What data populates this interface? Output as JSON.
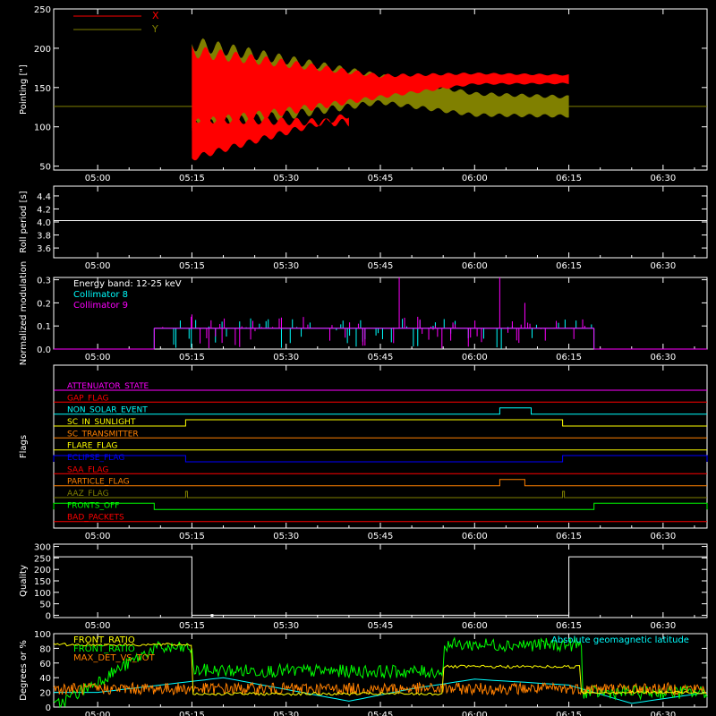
{
  "colors": {
    "background": "#000000",
    "axes": "#ffffff",
    "x_red": "#ff0000",
    "y_olive": "#808000",
    "cyan": "#00ffff",
    "magenta": "#ff00ff",
    "green": "#00ff00",
    "orange": "#ff8000",
    "yellow": "#ffff00",
    "blue": "#0000ff"
  },
  "time_ticks": [
    "05:00",
    "05:15",
    "05:30",
    "05:45",
    "06:00",
    "06:15",
    "06:30"
  ],
  "chart_data": [
    {
      "type": "line",
      "ylabel": "Pointing [\"]",
      "ylim": [
        45,
        250
      ],
      "yticks": [
        "50",
        "100",
        "150",
        "200",
        "250"
      ],
      "yticks_values": [
        50,
        100,
        150,
        200,
        250
      ],
      "x_range": [
        "04:53",
        "06:37"
      ],
      "series": [
        {
          "name": "X",
          "color": "#ff0000",
          "center": [
            126,
            126,
            145,
            158,
            158,
            126
          ],
          "amplitude": [
            0,
            70,
            20,
            10,
            8,
            0
          ],
          "x": [
            "04:53",
            "05:15",
            "05:45",
            "06:00",
            "06:15",
            "06:37"
          ]
        },
        {
          "name": "Y",
          "color": "#808000",
          "center": [
            126,
            126,
            140,
            122,
            120,
            126
          ],
          "amplitude": [
            0,
            80,
            25,
            20,
            18,
            0
          ],
          "x": [
            "04:53",
            "05:15",
            "05:45",
            "06:00",
            "06:15",
            "06:37"
          ]
        }
      ],
      "legend": [
        "X",
        "Y"
      ],
      "legend_position": "top-left"
    },
    {
      "type": "line",
      "ylabel": "Roll period [s]",
      "ylim": [
        3.45,
        4.55
      ],
      "yticks": [
        "3.6",
        "3.8",
        "4.0",
        "4.2",
        "4.4"
      ],
      "yticks_values": [
        3.6,
        3.8,
        4.0,
        4.2,
        4.4
      ],
      "series": [
        {
          "name": "",
          "x": [
            "04:53",
            "06:37"
          ],
          "y": [
            4.02,
            4.02
          ]
        }
      ]
    },
    {
      "type": "bar",
      "ylabel": "Normalized modulation",
      "ylim": [
        0,
        0.31
      ],
      "yticks": [
        "0.0",
        "0.1",
        "0.2",
        "0.3"
      ],
      "yticks_values": [
        0.0,
        0.1,
        0.2,
        0.3
      ],
      "annotation": "Energy band: 12-25 keV",
      "series": [
        {
          "name": "Collimator 8",
          "color": "#00ffff",
          "x_range": [
            "05:09",
            "06:19"
          ],
          "baseline": 0.09
        },
        {
          "name": "Collimator 9",
          "color": "#ff00ff",
          "x_range": [
            "05:09",
            "06:19"
          ],
          "baseline": 0.09
        }
      ],
      "legend_position": "top-left"
    },
    {
      "type": "line",
      "ylabel": "Flags",
      "flags": [
        {
          "name": "ATTENUATOR_STATE",
          "color": "#ff00ff",
          "on": []
        },
        {
          "name": "GAP_FLAG",
          "color": "#ff0000",
          "on": []
        },
        {
          "name": "NON_SOLAR_EVENT",
          "color": "#00ffff",
          "on": [
            [
              "06:04",
              "06:09"
            ]
          ]
        },
        {
          "name": "SC_IN_SUNLIGHT",
          "color": "#ffff00",
          "on": [
            [
              "05:14",
              "06:14"
            ]
          ]
        },
        {
          "name": "SC_TRANSMITTER",
          "color": "#ff8000",
          "on": []
        },
        {
          "name": "FLARE_FLAG",
          "color": "#ffff00",
          "on": []
        },
        {
          "name": "ECLIPSE_FLAG",
          "color": "#0000ff",
          "on": [
            [
              "04:53",
              "05:14"
            ],
            [
              "06:14",
              "06:37"
            ]
          ]
        },
        {
          "name": "SAA_FLAG",
          "color": "#ff0000",
          "on": []
        },
        {
          "name": "PARTICLE_FLAG",
          "color": "#ff8000",
          "on": [
            [
              "06:04",
              "06:08"
            ]
          ]
        },
        {
          "name": "AAZ_FLAG",
          "color": "#808000",
          "on": [
            [
              "05:14",
              "05:14"
            ],
            [
              "06:14",
              "06:14"
            ]
          ]
        },
        {
          "name": "FRONTS_OFF",
          "color": "#00ff00",
          "on": [
            [
              "04:53",
              "05:09"
            ],
            [
              "06:19",
              "06:37"
            ]
          ]
        },
        {
          "name": "BAD_PACKETS",
          "color": "#ff0000",
          "on": []
        }
      ]
    },
    {
      "type": "line",
      "ylabel": "Quality",
      "ylim": [
        -10,
        310
      ],
      "yticks": [
        "0",
        "50",
        "100",
        "150",
        "200",
        "250",
        "300"
      ],
      "yticks_values": [
        0,
        50,
        100,
        150,
        200,
        250,
        300
      ],
      "series": [
        {
          "name": "",
          "x": [
            "04:53",
            "05:15",
            "05:15",
            "06:15",
            "06:15",
            "06:37"
          ],
          "y": [
            255,
            255,
            0,
            0,
            255,
            255
          ]
        }
      ]
    },
    {
      "type": "line",
      "ylabel": "Degrees or %",
      "ylim": [
        0,
        100
      ],
      "yticks": [
        "0",
        "20",
        "40",
        "60",
        "80",
        "100"
      ],
      "yticks_values": [
        0,
        20,
        40,
        60,
        80,
        100
      ],
      "series": [
        {
          "name": "FRONT_RATIO",
          "color": "#ffff00",
          "x": [
            "04:53",
            "05:15",
            "05:15",
            "05:55",
            "05:55",
            "06:17",
            "06:17",
            "06:37"
          ],
          "y": [
            85,
            85,
            18,
            18,
            55,
            55,
            20,
            20
          ]
        },
        {
          "name": "FRONT_RATIO",
          "color": "#00ff00",
          "x": [
            "04:53",
            "05:09",
            "05:15",
            "05:15",
            "05:55",
            "05:55",
            "06:17",
            "06:17",
            "06:37"
          ],
          "y": [
            0,
            80,
            80,
            50,
            48,
            85,
            85,
            20,
            20
          ]
        },
        {
          "name": "MAX_DET_VS_TOT",
          "color": "#ff8000",
          "x": [
            "04:53",
            "06:37"
          ],
          "y": [
            25,
            25
          ]
        },
        {
          "name": "Absolute geomagnetic latitude",
          "color": "#00ffff",
          "x": [
            "04:53",
            "05:00",
            "05:20",
            "05:40",
            "05:50",
            "06:00",
            "06:15",
            "06:25",
            "06:37"
          ],
          "y": [
            20,
            20,
            40,
            8,
            25,
            38,
            30,
            5,
            20
          ]
        }
      ],
      "legend": [
        "FRONT_RATIO",
        "FRONT_RATIO",
        "MAX_DET_VS_TOT",
        "Absolute geomagnetic latitude"
      ],
      "legend_position": "top-left"
    }
  ]
}
